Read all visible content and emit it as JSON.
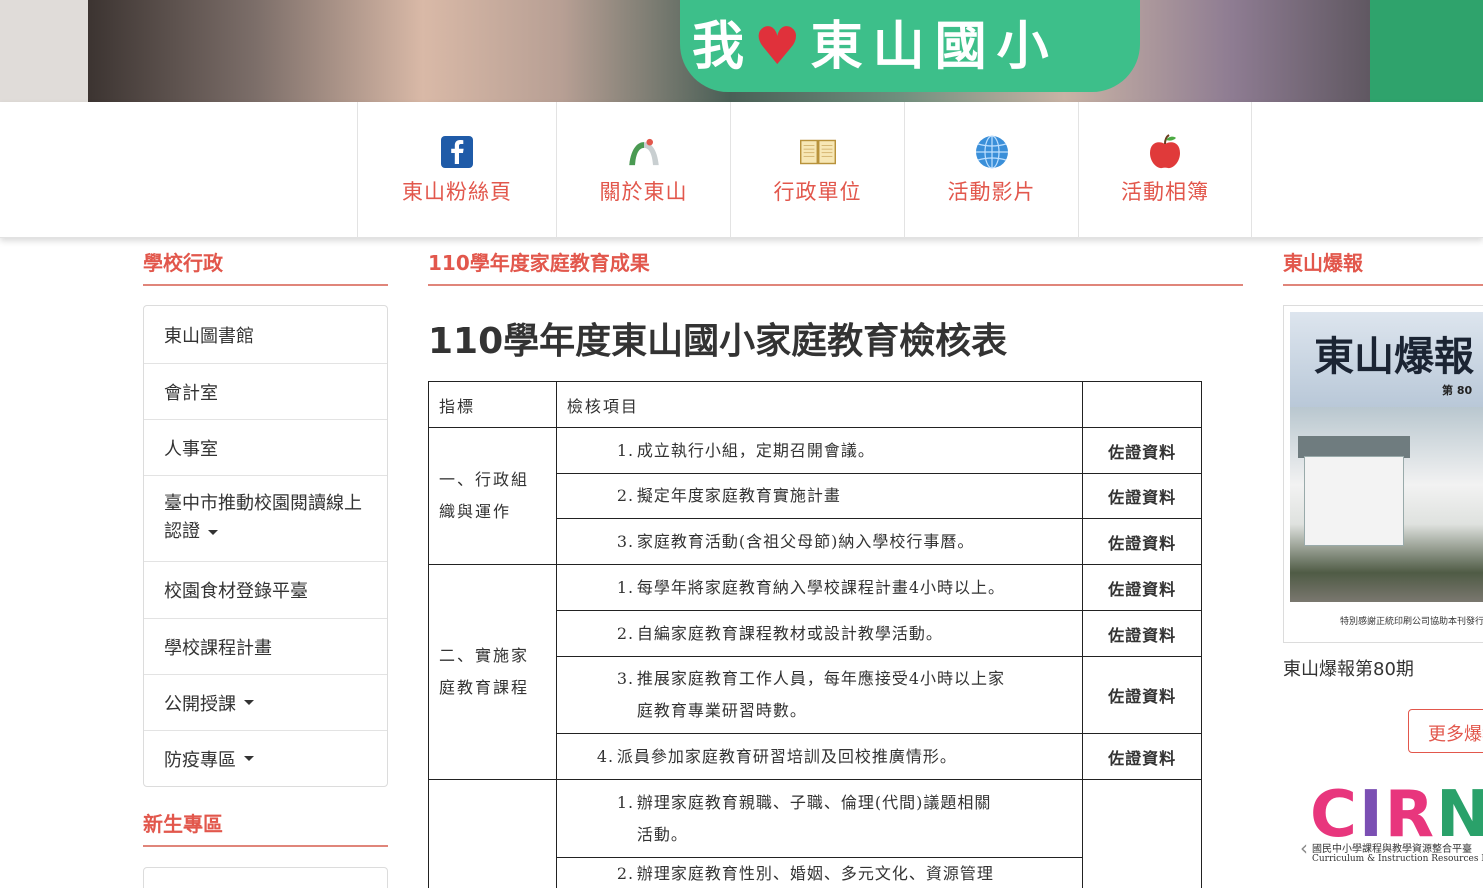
{
  "banner": {
    "sign_text_1": "我",
    "sign_heart": "♥",
    "sign_text_2": "東山國小"
  },
  "nav": {
    "items": [
      {
        "label": "東山粉絲頁",
        "icon": "facebook-icon"
      },
      {
        "label": "關於東山",
        "icon": "arch-icon"
      },
      {
        "label": "行政單位",
        "icon": "open-book-icon"
      },
      {
        "label": "活動影片",
        "icon": "globe-icon"
      },
      {
        "label": "活動相簿",
        "icon": "apple-icon"
      }
    ]
  },
  "sidebar": {
    "heading": "學校行政",
    "items": [
      {
        "label": "東山圖書館"
      },
      {
        "label": "會計室"
      },
      {
        "label": "人事室"
      },
      {
        "label": "臺中市推動校園閱讀線上認證"
      },
      {
        "label": "校園食材登錄平臺"
      },
      {
        "label": "學校課程計畫"
      },
      {
        "label": "公開授課"
      },
      {
        "label": "防疫專區"
      }
    ],
    "heading2": "新生專區"
  },
  "main": {
    "heading": "110學年度家庭教育成果",
    "title": "110學年度東山國小家庭教育檢核表",
    "table": {
      "col_indicator": "指標",
      "col_items": "檢核項目",
      "evidence_label": "佐證資料",
      "group1": {
        "indicator": "一、行政組織與運作",
        "items": [
          {
            "num": "1.",
            "text": "成立執行小組，定期召開會議。"
          },
          {
            "num": "2.",
            "text": "擬定年度家庭教育實施計畫"
          },
          {
            "num": "3.",
            "text": "家庭教育活動(含祖父母節)納入學校行事曆。"
          }
        ]
      },
      "group2": {
        "indicator": "二、實施家庭教育課程",
        "items": [
          {
            "num": "1.",
            "text": "每學年將家庭教育納入學校課程計畫4小時以上。"
          },
          {
            "num": "2.",
            "text": "自編家庭教育課程教材或設計教學活動。"
          },
          {
            "num": "3.",
            "text_line1": "推展家庭教育工作人員，每年應接受4小時以上家",
            "text_line2": "庭教育專業研習時數。"
          },
          {
            "num": "4.",
            "text": "派員參加家庭教育研習培訓及回校推廣情形。"
          }
        ]
      },
      "group3": {
        "items": [
          {
            "num": "1.",
            "text_line1": "辦理家庭教育親職、子職、倫理(代間)議題相關",
            "text_line2": "活動。"
          },
          {
            "num": "2.",
            "text_line1": "辦理家庭教育性別、婚姻、多元文化、資源管理"
          }
        ]
      }
    }
  },
  "right": {
    "heading": "東山爆報",
    "cover_title": "東山爆報",
    "cover_issue": "第 80",
    "cover_footer": "特別感謝正統印刷公司協助本刊發行",
    "caption": "東山爆報第80期",
    "more_label": "更多爆報",
    "cirn_logo": "CIRN",
    "cirn_sub1": "國民中小學課程與教學資源整合平臺",
    "cirn_sub2": "Curriculum & Instruction Resources Network"
  },
  "colors": {
    "accent": "#e2574c",
    "rule": "#e0857a",
    "sign_green": "#3dbf8a"
  }
}
